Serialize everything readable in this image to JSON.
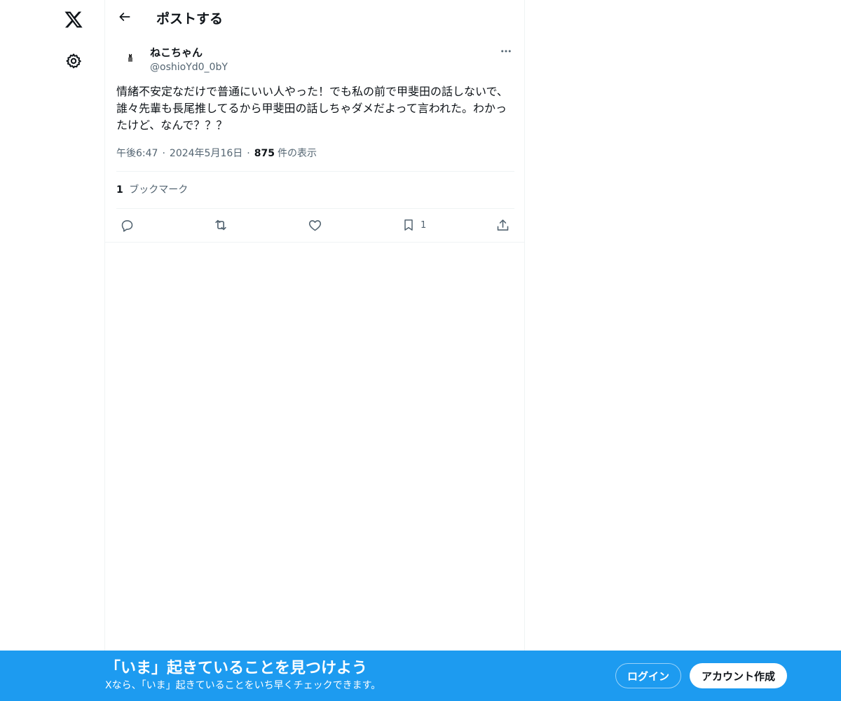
{
  "nav": {
    "logo_icon": "x-logo-icon",
    "settings_icon": "gear-icon"
  },
  "header": {
    "back_icon": "arrow-left-icon",
    "title": "ポストする"
  },
  "post": {
    "author_name": "ねこちゃん",
    "author_handle": "@oshioYd0_0bY",
    "more_icon": "ellipsis-icon",
    "text": "情緒不安定なだけで普通にいい人やった！でも私の前で甲斐田の話しないで、誰々先輩も長尾推してるから甲斐田の話しちゃダメだよって言われた。わかったけど、なんで？？？",
    "time": "午後6:47",
    "date": "2024年5月16日",
    "views_count": "875",
    "views_label": "件の表示",
    "meta_separator": "·",
    "bookmark_count": "1",
    "bookmark_label": "ブックマーク"
  },
  "actions": {
    "reply_icon": "reply-icon",
    "repost_icon": "repost-icon",
    "like_icon": "heart-icon",
    "bookmark_icon": "bookmark-icon",
    "bookmark_count": "1",
    "share_icon": "share-icon"
  },
  "banner": {
    "title": "「いま」起きていることを見つけよう",
    "subtitle": "Xなら、「いま」起きていることをいち早くチェックできます。",
    "login_label": "ログイン",
    "signup_label": "アカウント作成"
  },
  "colors": {
    "accent": "#1d9bf0",
    "text_primary": "#0f1419",
    "text_secondary": "#536471",
    "border": "#eff3f4"
  }
}
